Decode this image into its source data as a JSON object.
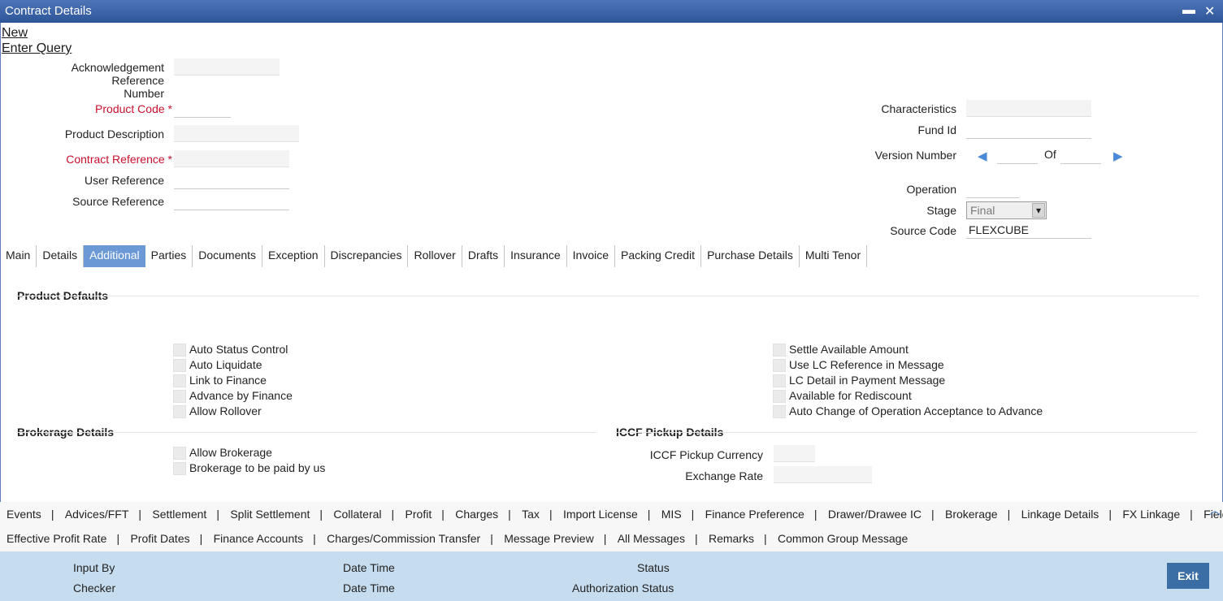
{
  "window": {
    "title": "Contract Details",
    "minimize": "▬",
    "close": "✕"
  },
  "actions": {
    "new": "New",
    "enter_query": "Enter Query"
  },
  "left_fields": {
    "ack_ref_label_1": "Acknowledgement Reference",
    "ack_ref_label_2": "Number",
    "product_code_label": "Product Code",
    "product_desc_label": "Product Description",
    "contract_ref_label": "Contract Reference",
    "user_ref_label": "User Reference",
    "source_ref_label": "Source Reference",
    "required_mark": "*"
  },
  "right_fields": {
    "characteristics_label": "Characteristics",
    "fund_id_label": "Fund Id",
    "version_number_label": "Version Number",
    "of_label": "Of",
    "operation_label": "Operation",
    "stage_label": "Stage",
    "stage_value": "Final",
    "source_code_label": "Source Code",
    "source_code_value": "FLEXCUBE"
  },
  "tabs": [
    "Main",
    "Details",
    "Additional",
    "Parties",
    "Documents",
    "Exception",
    "Discrepancies",
    "Rollover",
    "Drafts",
    "Insurance",
    "Invoice",
    "Packing Credit",
    "Purchase Details",
    "Multi Tenor"
  ],
  "active_tab": "Additional",
  "product_defaults": {
    "title": "Product Defaults",
    "left": [
      "Auto Status Control",
      "Auto Liquidate",
      "Link to Finance",
      "Advance by Finance",
      "Allow Rollover"
    ],
    "right": [
      "Settle Available Amount",
      "Use LC Reference in Message",
      "LC Detail in Payment Message",
      "Available for Rediscount",
      "Auto Change of Operation Acceptance to Advance"
    ]
  },
  "brokerage": {
    "title": "Brokerage Details",
    "items": [
      "Allow Brokerage",
      "Brokerage to be paid by us"
    ]
  },
  "iccf": {
    "title": "ICCF Pickup Details",
    "currency_label": "ICCF Pickup Currency",
    "rate_label": "Exchange Rate"
  },
  "bottom_links_row1": [
    "Events",
    "Advices/FFT",
    "Settlement",
    "Split Settlement",
    "Collateral",
    "Profit",
    "Charges",
    "Tax",
    "Import License",
    "MIS",
    "Finance Preference",
    "Drawer/Drawee IC",
    "Brokerage",
    "Linkage Details",
    "FX Linkage",
    "Fields"
  ],
  "bottom_links_row2": [
    "Effective Profit Rate",
    "Profit Dates",
    "Finance Accounts",
    "Charges/Commission Transfer",
    "Message Preview",
    "All Messages",
    "Remarks",
    "Common Group Message"
  ],
  "separator": "|",
  "footer": {
    "input_by": "Input By",
    "checker": "Checker",
    "date_time": "Date Time",
    "status": "Status",
    "auth_status": "Authorization Status",
    "exit": "Exit"
  },
  "icons": {
    "prev": "◀",
    "next": "▶",
    "scroll_up": "︿",
    "dropdown": "▾"
  }
}
